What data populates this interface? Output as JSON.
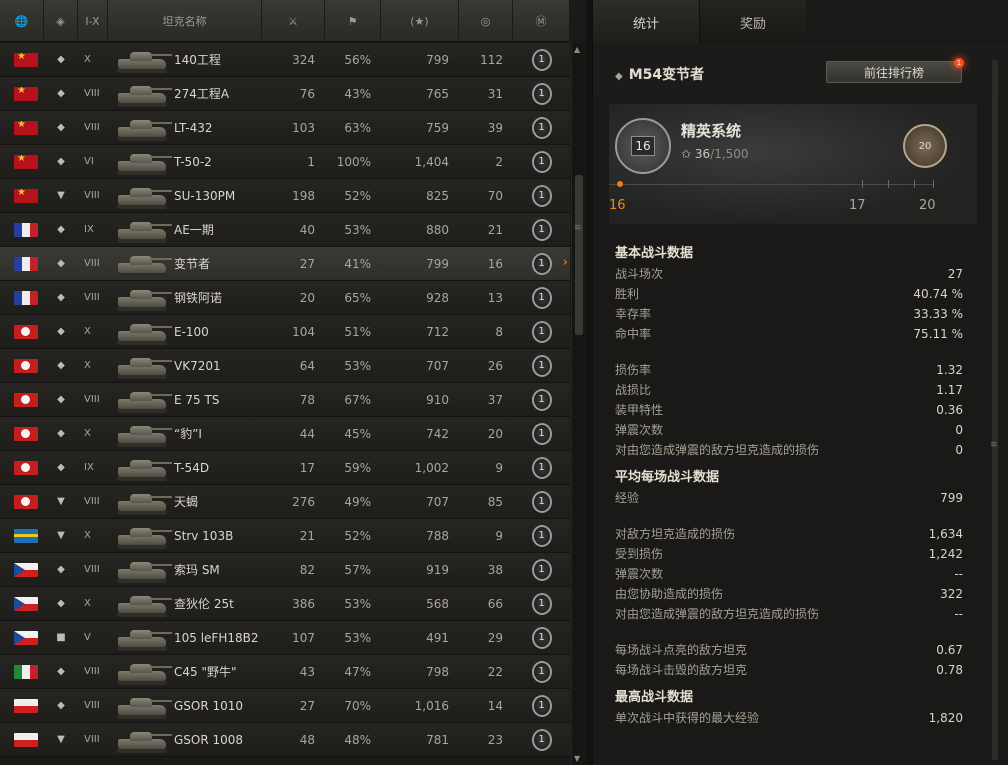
{
  "headers": {
    "nation_icon": "globe-icon",
    "type_icon": "vehicle-type-icon",
    "tier": "I-X",
    "name": "坦克名称",
    "battles_icon": "crossed-swords-icon",
    "wins_icon": "flag-icon",
    "exp_icon": "star-icon",
    "class_icon": "class-mark-icon",
    "mastery_icon": "mastery-icon"
  },
  "tanks": [
    {
      "nation": "ussr",
      "type": "◆",
      "tier": "X",
      "name": "140工程",
      "battles": "324",
      "winrate": "56%",
      "exp": "799",
      "marks": "112",
      "mastery": "1"
    },
    {
      "nation": "ussr",
      "type": "◆",
      "tier": "VIII",
      "name": "274工程A",
      "battles": "76",
      "winrate": "43%",
      "exp": "765",
      "marks": "31",
      "mastery": "1"
    },
    {
      "nation": "ussr",
      "type": "◆",
      "tier": "VIII",
      "name": "LT-432",
      "battles": "103",
      "winrate": "63%",
      "exp": "759",
      "marks": "39",
      "mastery": "1"
    },
    {
      "nation": "ussr",
      "type": "◆",
      "tier": "VI",
      "name": "T-50-2",
      "battles": "1",
      "winrate": "100%",
      "exp": "1,404",
      "marks": "2",
      "mastery": "1"
    },
    {
      "nation": "ussr",
      "type": "▼",
      "tier": "VIII",
      "name": "SU-130PM",
      "battles": "198",
      "winrate": "52%",
      "exp": "825",
      "marks": "70",
      "mastery": "1"
    },
    {
      "nation": "fr",
      "type": "◆",
      "tier": "IX",
      "name": "AE一期",
      "battles": "40",
      "winrate": "53%",
      "exp": "880",
      "marks": "21",
      "mastery": "1"
    },
    {
      "nation": "fr",
      "type": "◆",
      "tier": "VIII",
      "name": "变节者",
      "battles": "27",
      "winrate": "41%",
      "exp": "799",
      "marks": "16",
      "mastery": "1"
    },
    {
      "nation": "fr",
      "type": "◆",
      "tier": "VIII",
      "name": "钢铁阿诺",
      "battles": "20",
      "winrate": "65%",
      "exp": "928",
      "marks": "13",
      "mastery": "1"
    },
    {
      "nation": "ger",
      "type": "◆",
      "tier": "X",
      "name": "E-100",
      "battles": "104",
      "winrate": "51%",
      "exp": "712",
      "marks": "8",
      "mastery": "1"
    },
    {
      "nation": "ger",
      "type": "◆",
      "tier": "X",
      "name": "VK7201",
      "battles": "64",
      "winrate": "53%",
      "exp": "707",
      "marks": "26",
      "mastery": "1"
    },
    {
      "nation": "ger",
      "type": "◆",
      "tier": "VIII",
      "name": "E 75 TS",
      "battles": "78",
      "winrate": "67%",
      "exp": "910",
      "marks": "37",
      "mastery": "1"
    },
    {
      "nation": "ger",
      "type": "◆",
      "tier": "X",
      "name": "“豹”I",
      "battles": "44",
      "winrate": "45%",
      "exp": "742",
      "marks": "20",
      "mastery": "1"
    },
    {
      "nation": "ger",
      "type": "◆",
      "tier": "IX",
      "name": "T-54D",
      "battles": "17",
      "winrate": "59%",
      "exp": "1,002",
      "marks": "9",
      "mastery": "1"
    },
    {
      "nation": "ger",
      "type": "▼",
      "tier": "VIII",
      "name": "天蝎",
      "battles": "276",
      "winrate": "49%",
      "exp": "707",
      "marks": "85",
      "mastery": "1"
    },
    {
      "nation": "swe",
      "type": "▼",
      "tier": "X",
      "name": "Strv 103B",
      "battles": "21",
      "winrate": "52%",
      "exp": "788",
      "marks": "9",
      "mastery": "1"
    },
    {
      "nation": "cz",
      "type": "◆",
      "tier": "VIII",
      "name": "索玛 SM",
      "battles": "82",
      "winrate": "57%",
      "exp": "919",
      "marks": "38",
      "mastery": "1"
    },
    {
      "nation": "cz",
      "type": "◆",
      "tier": "X",
      "name": "查狄伦 25t",
      "battles": "386",
      "winrate": "53%",
      "exp": "568",
      "marks": "66",
      "mastery": "1"
    },
    {
      "nation": "cz",
      "type": "■",
      "tier": "V",
      "name": "105 leFH18B2",
      "battles": "107",
      "winrate": "53%",
      "exp": "491",
      "marks": "29",
      "mastery": "1"
    },
    {
      "nation": "it",
      "type": "◆",
      "tier": "VIII",
      "name": "C45 \"野牛\"",
      "battles": "43",
      "winrate": "47%",
      "exp": "798",
      "marks": "22",
      "mastery": "1"
    },
    {
      "nation": "pl",
      "type": "◆",
      "tier": "VIII",
      "name": "GSOR 1010",
      "battles": "27",
      "winrate": "70%",
      "exp": "1,016",
      "marks": "14",
      "mastery": "1"
    },
    {
      "nation": "pl",
      "type": "▼",
      "tier": "VIII",
      "name": "GSOR 1008",
      "battles": "48",
      "winrate": "48%",
      "exp": "781",
      "marks": "23",
      "mastery": "1"
    }
  ],
  "selected_index": 6,
  "tabs": {
    "stats": "统计",
    "rewards": "奖励"
  },
  "panel": {
    "vehicle_type": "◆",
    "vehicle_name": "M54变节者",
    "ranking_button": "前往排行榜",
    "notification_count": "1"
  },
  "elite": {
    "title": "精英系统",
    "badge_level": "16",
    "prestige_level": "20",
    "progress_current": "36",
    "progress_max": "/1,500",
    "levels": [
      "16",
      "17",
      "20"
    ],
    "progress_fraction": 0.024
  },
  "sections": [
    {
      "title": "基本战斗数据",
      "rows": [
        {
          "label": "战斗场次",
          "value": "27"
        },
        {
          "label": "胜利",
          "value": "40.74 %"
        },
        {
          "label": "幸存率",
          "value": "33.33 %"
        },
        {
          "label": "命中率",
          "value": "75.11 %"
        }
      ]
    },
    {
      "title": "",
      "rows": [
        {
          "label": "损伤率",
          "value": "1.32"
        },
        {
          "label": "战损比",
          "value": "1.17"
        },
        {
          "label": "装甲特性",
          "value": "0.36"
        },
        {
          "label": "弹震次数",
          "value": "0"
        },
        {
          "label": "对由您造成弹震的敌方坦克造成的损伤",
          "value": "0"
        }
      ]
    },
    {
      "title": "平均每场战斗数据",
      "rows": [
        {
          "label": "经验",
          "value": "799"
        }
      ]
    },
    {
      "title": "",
      "rows": [
        {
          "label": "对敌方坦克造成的损伤",
          "value": "1,634"
        },
        {
          "label": "受到损伤",
          "value": "1,242"
        },
        {
          "label": "弹震次数",
          "value": "--"
        },
        {
          "label": "由您协助造成的损伤",
          "value": "322"
        },
        {
          "label": "对由您造成弹震的敌方坦克造成的损伤",
          "value": "--"
        }
      ]
    },
    {
      "title": "",
      "rows": [
        {
          "label": "每场战斗点亮的敌方坦克",
          "value": "0.67"
        },
        {
          "label": "每场战斗击毁的敌方坦克",
          "value": "0.78"
        }
      ]
    },
    {
      "title": "最高战斗数据",
      "rows": [
        {
          "label": "单次战斗中获得的最大经验",
          "value": "1,820"
        }
      ]
    }
  ],
  "colors": {
    "accent": "#f08a1c",
    "ussr": "#b5121b",
    "ger": "#c41e1e"
  }
}
